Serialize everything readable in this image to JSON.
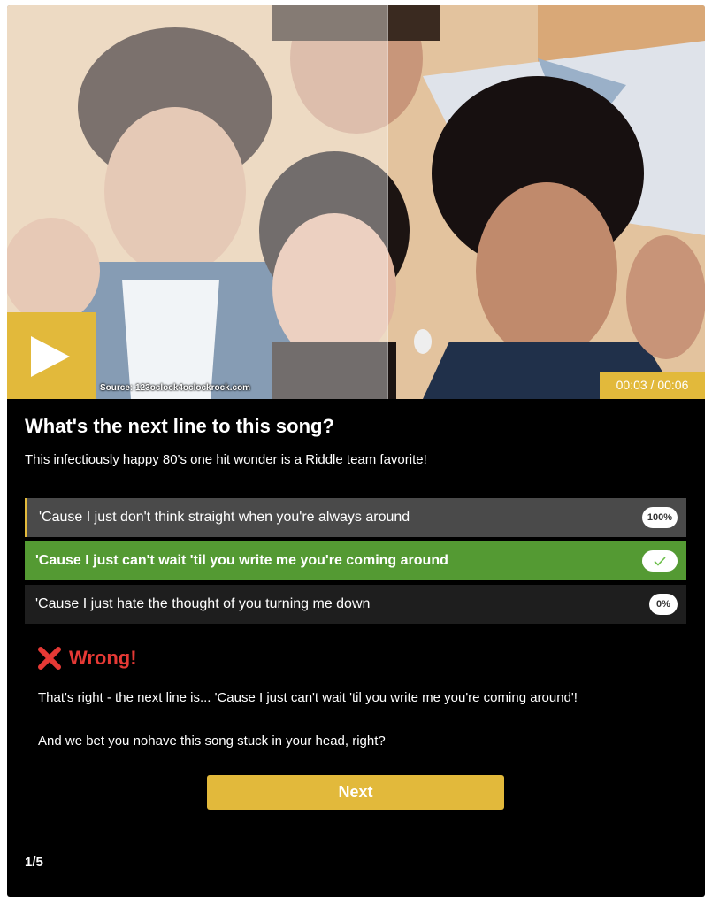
{
  "media": {
    "play_icon": "play-icon",
    "source": "Source: 123oclock4oclockrock.com",
    "timer": "00:03 / 00:06"
  },
  "quiz": {
    "question": "What's the next line to this song?",
    "subtitle": "This infectiously happy 80's one hit wonder is a Riddle team favorite!",
    "answers": [
      {
        "text": "'Cause I just don't think straight when you're always around",
        "badge": "100%",
        "state": "selected"
      },
      {
        "text": "'Cause I just can't wait 'til you write me you're coming around",
        "badge_icon": "check-icon",
        "state": "correct"
      },
      {
        "text": "'Cause I just hate the thought of you turning me down",
        "badge": "0%",
        "state": "default"
      }
    ],
    "result": {
      "icon": "x-mark-icon",
      "label": "Wrong!"
    },
    "feedback": [
      "That's right - the next line is... 'Cause I just can't wait 'til you write me you're coming around'!",
      "And we bet you nohave this song stuck in your head, right?"
    ],
    "next_label": "Next",
    "progress": "1/5"
  },
  "colors": {
    "accent": "#e2b93b",
    "correct": "#549a33",
    "wrong": "#e53935",
    "background": "#000000"
  }
}
